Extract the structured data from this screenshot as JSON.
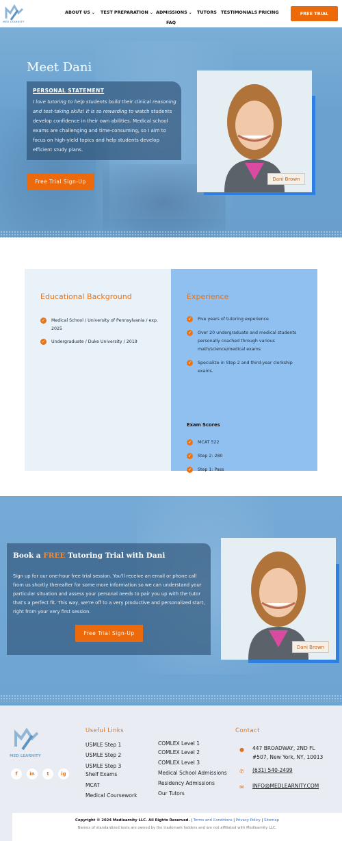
{
  "header": {
    "logo_text": "MED LEARNITY",
    "nav": [
      {
        "label": "ABOUT US",
        "chevron": true
      },
      {
        "label": "TEST PREPARATION",
        "chevron": true
      },
      {
        "label": "ADMISSIONS",
        "chevron": true
      },
      {
        "label": "TUTORS",
        "chevron": false
      },
      {
        "label": "TESTIMONIALS",
        "chevron": false
      },
      {
        "label": "PRICING",
        "chevron": false
      },
      {
        "label": "FAQ",
        "chevron": false
      }
    ],
    "cta": "FREE TRIAL"
  },
  "hero": {
    "title": "Meet Dani",
    "statement_heading": "PERSONAL STATEMENT",
    "statement_italic": "I love tutoring to help students build their clinical reasoning and test-taking skills! It is so rewarding to",
    "statement_rest": " watch students develop confidence in their own abilities. Medical school exams are challenging and time-consuming, so I aim to focus on high-yield topics and help students develop efficient study plans.",
    "cta": "Free Trial Sign-Up",
    "tutor_name": "Dani Brown"
  },
  "background": {
    "education_title": "Educational Background",
    "education": [
      "Medical School / University of Pennsylvania / exp. 2025",
      "Undergraduate / Duke University / 2019"
    ],
    "experience_title": "Experience",
    "experience": [
      "Five years of tutoring experience",
      "Over 20 undergraduate and medical students personally coached through various math/science/medical exams",
      "Specialize in Step 2 and third-year clerkship exams."
    ],
    "exam_scores_title": "Exam Scores",
    "exam_scores": [
      "MCAT 522",
      "Step 2: 280",
      "Step 1: Pass"
    ]
  },
  "trial": {
    "title_pre": "Book a ",
    "title_free": "FREE",
    "title_post": " Tutoring Trial with Dani",
    "text": "Sign up for our one-hour free trial session. You'll receive an email or phone call from us shortly thereafter for some more information so we can understand your particular situation and assess your personal needs to pair you up with the tutor that's a perfect fit. This way, we're off to a very productive and personalized start, right from your very first session.",
    "cta": "Free Trial Sign-Up",
    "tutor_name": "Dani Brown"
  },
  "footer": {
    "logo_text": "MED LEARNITY",
    "useful_links_title": "Useful Links",
    "links_col1": [
      "USMLE Step 1",
      "USMLE Step 2",
      "USMLE Step 3",
      "Shelf Exams",
      "MCAT",
      "Medical Coursework"
    ],
    "links_col2": [
      "COMLEX Level 1",
      "COMLEX Level 2",
      "COMLEX Level 3",
      "Medical School Admissions",
      "Residency Admissions",
      "Our Tutors"
    ],
    "contact_title": "Contact",
    "address_line1": "447 BROADWAY, 2ND FL",
    "address_line2": "#507, New York, NY, 10013",
    "phone": "(631) 540-2499",
    "email": "INFO@MEDLEARNITY.COM",
    "social": [
      "f",
      "in",
      "t",
      "ig"
    ],
    "copyright": "Copyright © 2024 Medlearnity LLC. All Rights Reserved.",
    "terms": "Terms and Conditions",
    "privacy": "Privacy Policy",
    "sitemap": "Sitemap",
    "disclaimer": "Names of standardized tests are owned by the trademark holders and are not affiliated with Medlearnity LLC."
  },
  "colors": {
    "accent": "#ec6a0c",
    "blue": "#2f7fe0",
    "hero_bg": "#6aa2cf"
  }
}
